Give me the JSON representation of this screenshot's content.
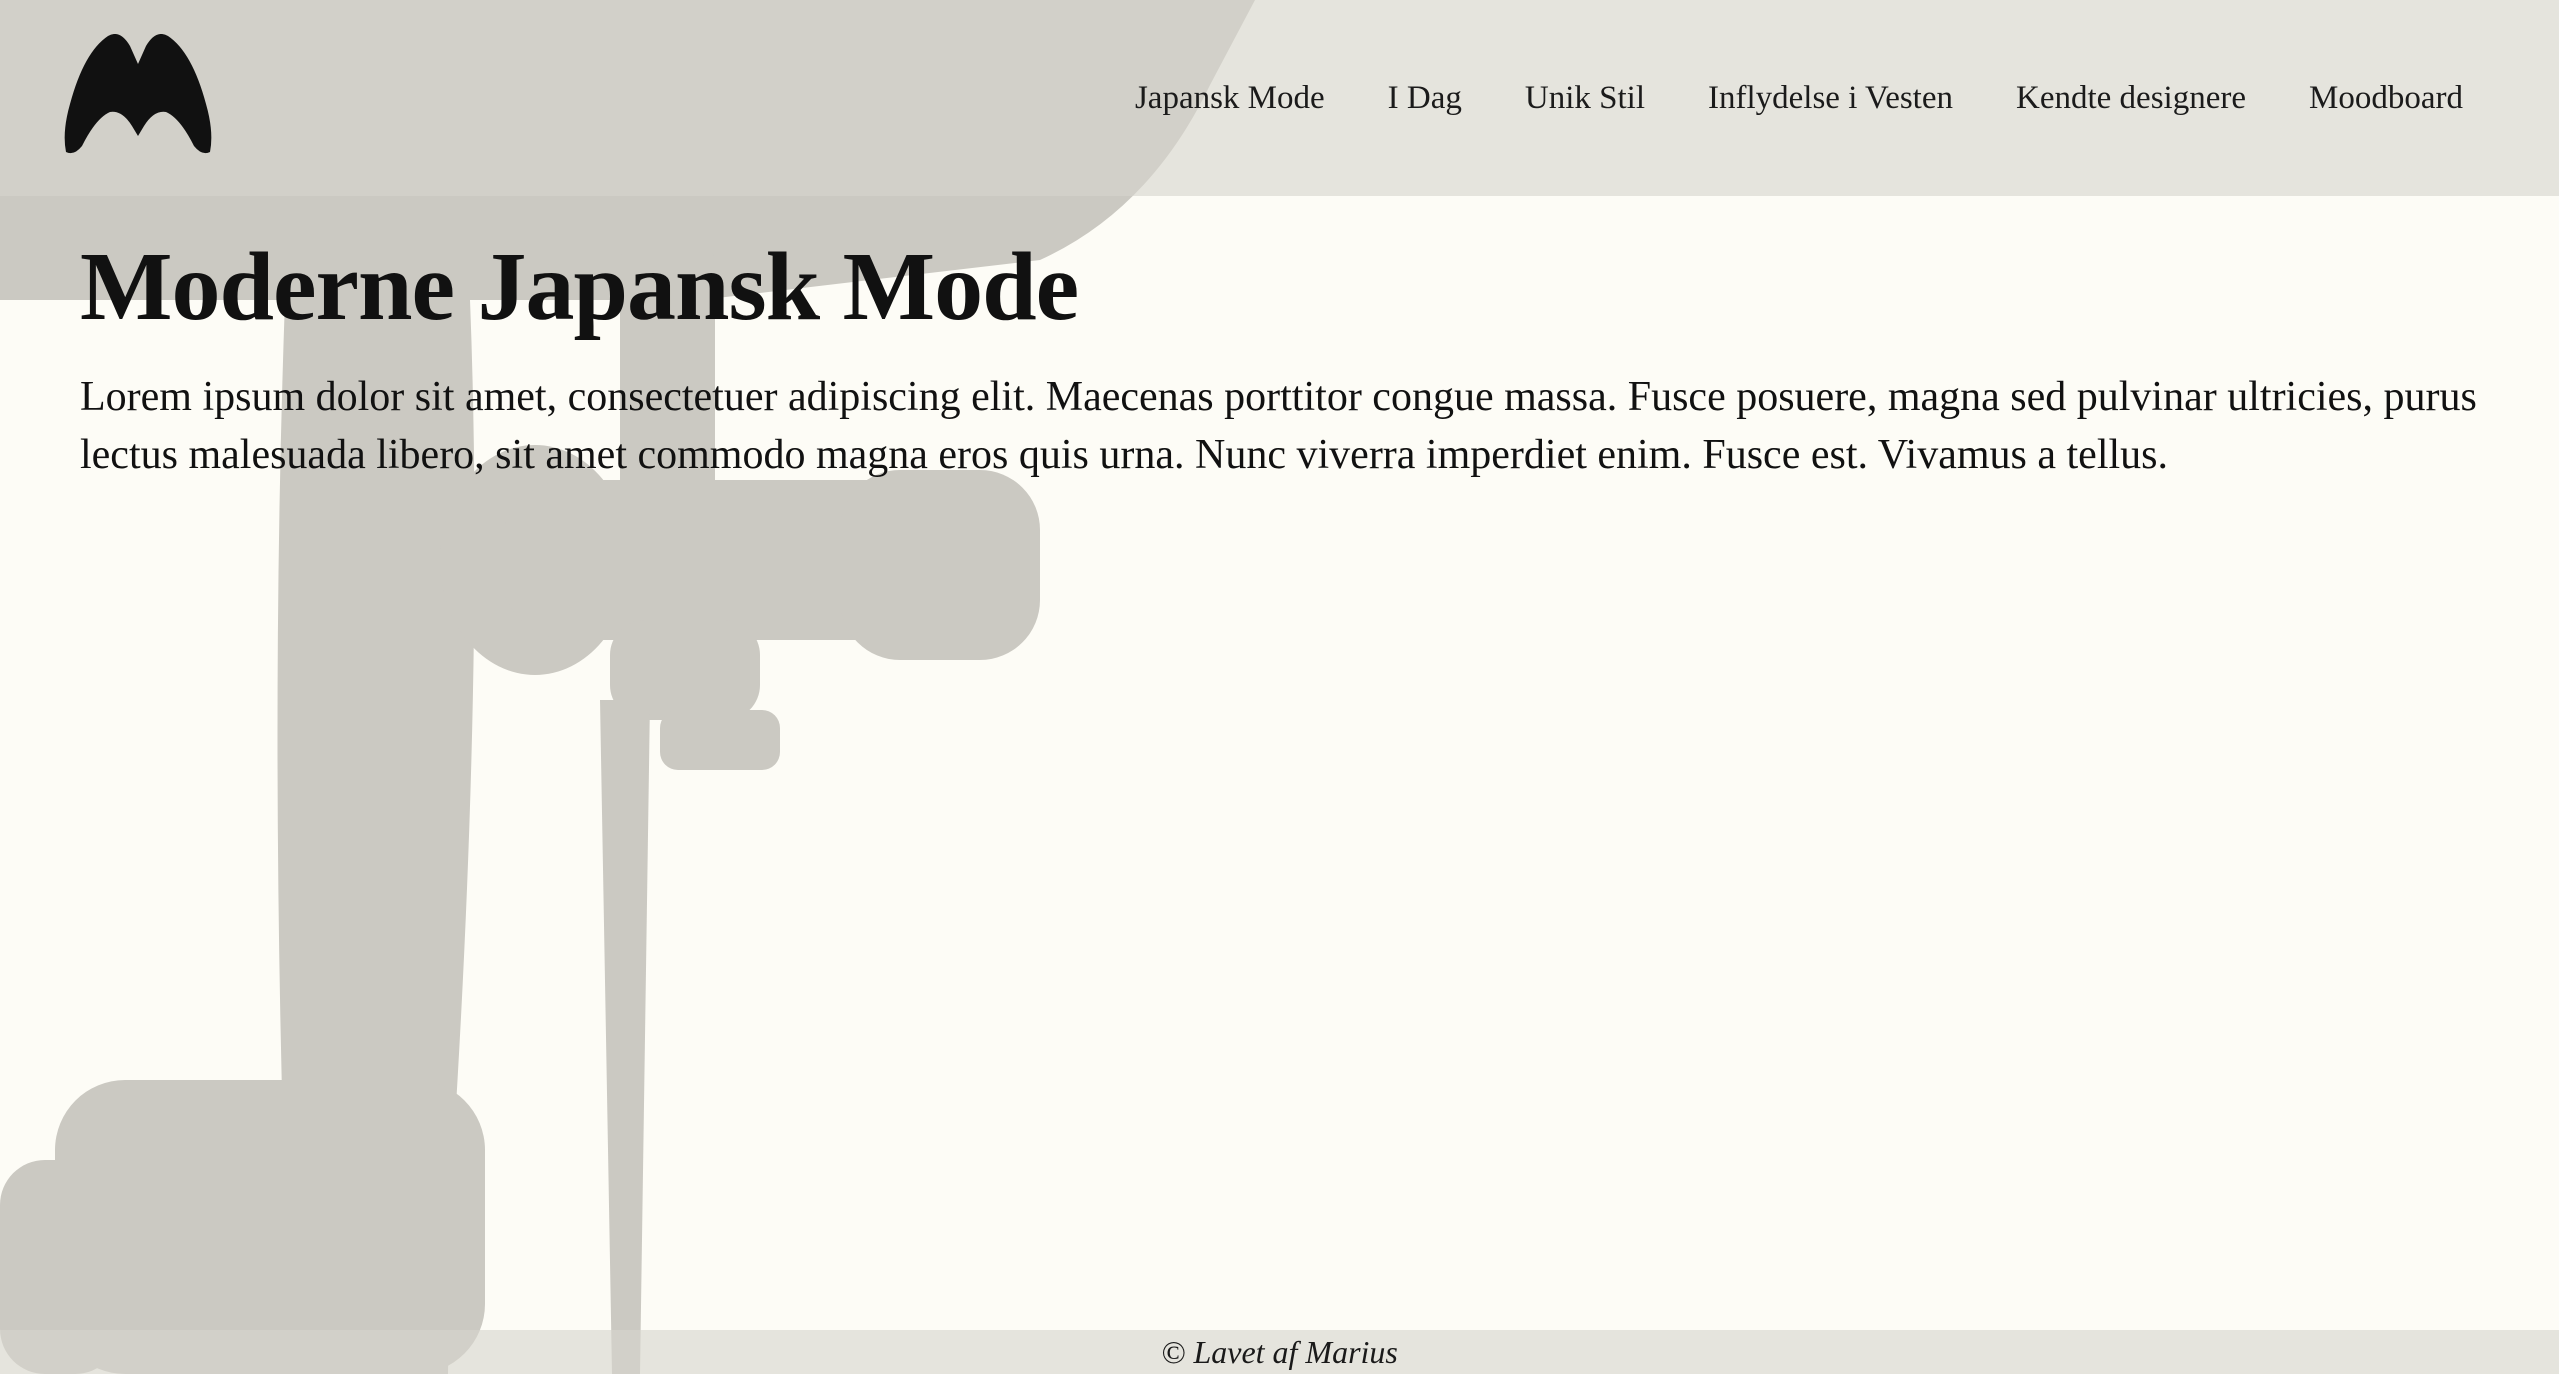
{
  "brand": {
    "logo_icon": "m-logo-icon",
    "logo_color": "#111111"
  },
  "nav": {
    "items": [
      {
        "label": "Japansk Mode"
      },
      {
        "label": "I Dag"
      },
      {
        "label": "Unik Stil"
      },
      {
        "label": "Inflydelse i Vesten"
      },
      {
        "label": "Kendte designere"
      },
      {
        "label": "Moodboard"
      }
    ]
  },
  "main": {
    "title": "Moderne Japansk Mode",
    "intro": "Lorem ipsum dolor sit amet, consectetuer adipiscing elit. Maecenas porttitor congue massa. Fusce posuere, magna sed pulvinar ultricies, purus lectus malesuada libero, sit amet commodo magna eros quis urna. Nunc viverra imperdiet enim. Fusce est. Vivamus a tellus."
  },
  "footer": {
    "credit": "© Lavet af Marius"
  },
  "colors": {
    "page_background": "#fdfcf6",
    "band_background": "#d7d5cd",
    "background_art": "#cbc9c2",
    "text": "#111111"
  }
}
